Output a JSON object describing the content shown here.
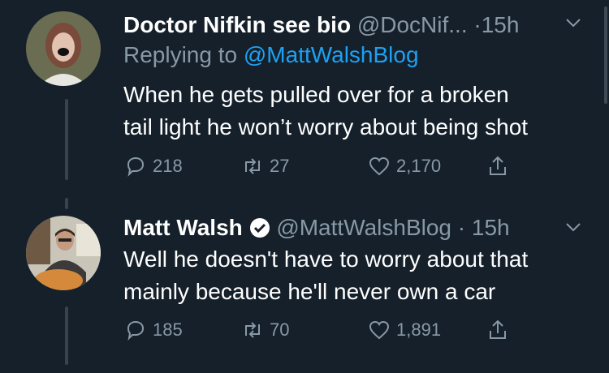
{
  "tweets": [
    {
      "name": "Doctor Nifkin see bio",
      "handle": "@DocNif...",
      "dot": "·",
      "time": "15h",
      "replying_prefix": "Replying to",
      "replying_to": "@MattWalshBlog",
      "text_line1": "When he gets pulled over for a broken",
      "text_line2": "tail light he won’t worry about being shot",
      "replies": "218",
      "retweets": "27",
      "likes": "2,170"
    },
    {
      "name": "Matt Walsh",
      "handle": "@MattWalshBlog",
      "dot": "·",
      "time": "15h",
      "text_line1": "Well he doesn't have to worry about that",
      "text_line2": "mainly because he'll never own a car",
      "replies": "185",
      "retweets": "70",
      "likes": "1,891"
    }
  ],
  "icons": {
    "reply": "reply-icon",
    "retweet": "retweet-icon",
    "like": "heart-icon",
    "share": "share-icon",
    "more": "chevron-down-icon",
    "verified": "verified-badge-icon"
  },
  "colors": {
    "background": "#15202b",
    "secondary_text": "#8899a6",
    "link": "#1da1f2",
    "thread_line": "#38444d"
  }
}
